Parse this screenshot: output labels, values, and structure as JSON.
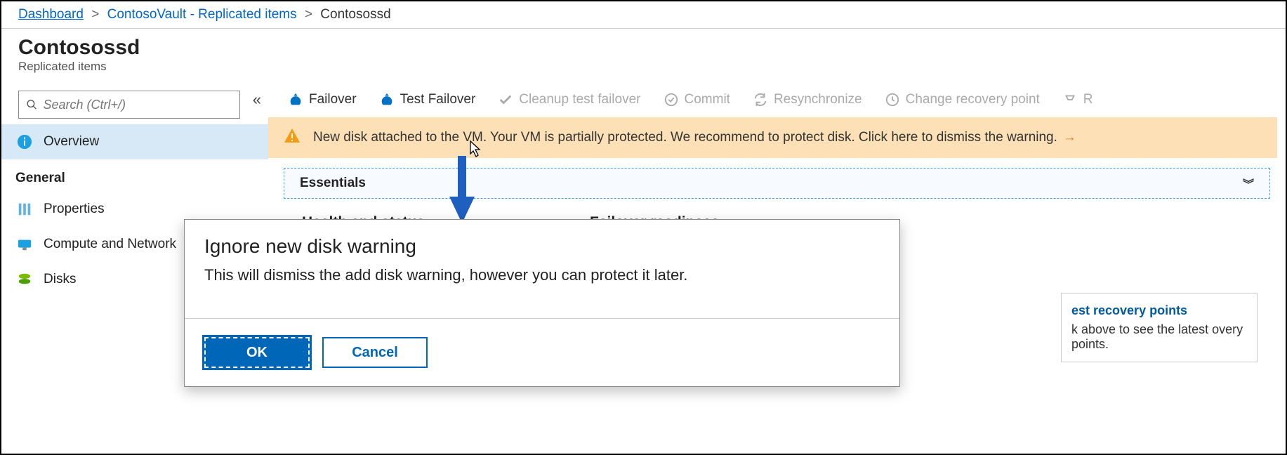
{
  "breadcrumb": {
    "items": [
      {
        "label": "Dashboard"
      },
      {
        "label": "ContosoVault - Replicated items"
      },
      {
        "label": "Contosossd"
      }
    ]
  },
  "header": {
    "title": "Contosossd",
    "subtitle": "Replicated items"
  },
  "search": {
    "placeholder": "Search (Ctrl+/)"
  },
  "sidebar": {
    "section_general": "General",
    "items": {
      "overview": "Overview",
      "properties": "Properties",
      "compute_network": "Compute and Network",
      "disks": "Disks"
    }
  },
  "toolbar": {
    "failover": "Failover",
    "test_failover": "Test Failover",
    "cleanup": "Cleanup test failover",
    "commit": "Commit",
    "resync": "Resynchronize",
    "change_rp": "Change recovery point",
    "more": "R"
  },
  "warning": {
    "text": "New disk attached to the VM. Your VM is partially protected. We recommend to protect disk. Click here to dismiss the warning."
  },
  "essentials": {
    "label": "Essentials"
  },
  "sections": {
    "health": "Health and status",
    "failover_readiness": "Failover readiness"
  },
  "recovery_card": {
    "title": "est recovery points",
    "body": "k above to see the latest overy points."
  },
  "dialog": {
    "title": "Ignore new disk warning",
    "body": "This will dismiss the add disk warning, however you can protect it later.",
    "ok": "OK",
    "cancel": "Cancel"
  }
}
